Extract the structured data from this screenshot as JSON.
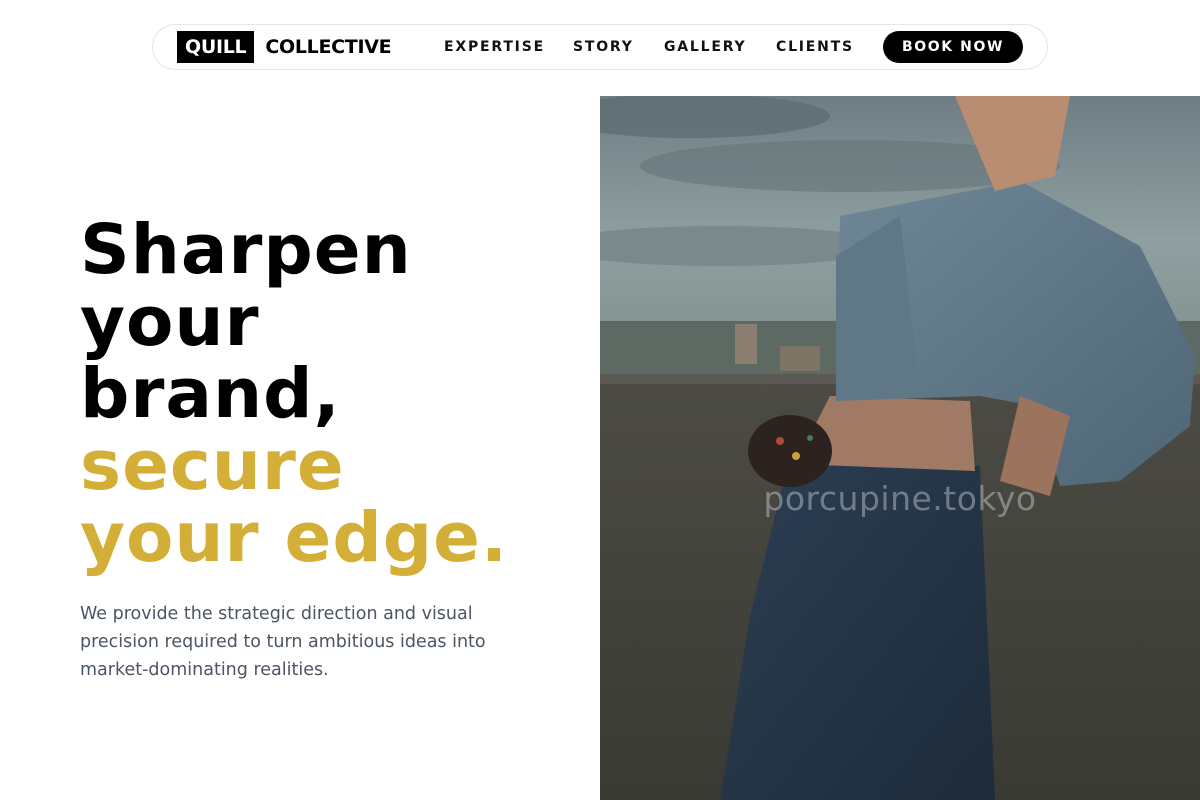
{
  "nav": {
    "logo_box": "QUILL",
    "logo_text": "COLLECTIVE",
    "links": [
      "EXPERTISE",
      "STORY",
      "GALLERY",
      "CLIENTS"
    ],
    "cta": "BOOK NOW"
  },
  "hero": {
    "headline_lines": [
      "Sharpen",
      "your",
      "brand,"
    ],
    "accent_lines": [
      "secure",
      "your edge."
    ],
    "subtext": "We provide the strategic direction and visual precision required to turn ambitious ideas into market-dominating realities.",
    "watermark": "porcupine.tokyo"
  },
  "colors": {
    "accent": "#d4af37",
    "text": "#000000",
    "muted": "#4b5563"
  }
}
